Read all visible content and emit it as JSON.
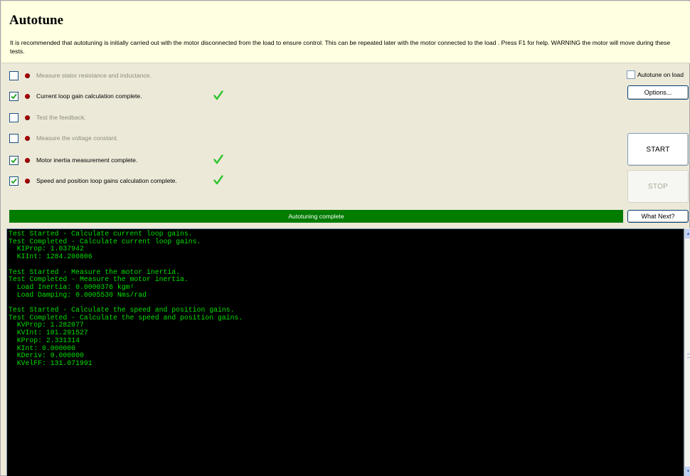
{
  "header": {
    "title": "Autotune",
    "description": "It is recommended that autotuning is initially carried out with the motor disconnected from the load to ensure control. This can be repeated later with the motor connected to the load . Press F1 for help. WARNING the motor will move during these tests."
  },
  "tasks": [
    {
      "label": "Measure stator resistance and inductance.",
      "checked": false,
      "complete": false
    },
    {
      "label": "Current loop gain calculation complete.",
      "checked": true,
      "complete": true
    },
    {
      "label": "Test the feedback.",
      "checked": false,
      "complete": false
    },
    {
      "label": "Measure the voltage constant.",
      "checked": false,
      "complete": false
    },
    {
      "label": "Motor inertia measurement complete.",
      "checked": true,
      "complete": true
    },
    {
      "label": "Speed and position loop gains calculation complete.",
      "checked": true,
      "complete": true
    }
  ],
  "options": {
    "autotune_on_load_label": "Autotune on load",
    "autotune_on_load_checked": false,
    "options_button": "Options...",
    "start_button": "START",
    "stop_button": "STOP",
    "what_next_button": "What Next?"
  },
  "status": {
    "text": "Autotuning complete",
    "color": "#007c00"
  },
  "console": {
    "text_color": "#00e000",
    "lines": [
      "Test Started - Calculate current loop gains.",
      "Test Completed - Calculate current loop gains.",
      "  KIProp: 1.037942",
      "  KIInt: 1284.200806",
      "",
      "Test Started - Measure the motor inertia.",
      "Test Completed - Measure the motor inertia.",
      "  Load Inertia: 0.0000376 kgm²",
      "  Load Damping: 0.0005530 Nms/rad",
      "",
      "Test Started - Calculate the speed and position gains.",
      "Test Completed - Calculate the speed and position gains.",
      "  KVProp: 1.282077",
      "  KVInt: 101.291527",
      "  KProp: 2.331314",
      "  KInt: 0.000000",
      "  KDeriv: 0.000000",
      "  KVelFF: 131.071991"
    ]
  },
  "icons": {
    "check": "checkmark-icon",
    "tick": "green-tick-icon",
    "status_dot": "status-dot-icon",
    "scroll_up": "scroll-up-arrow-icon",
    "scroll_down": "scroll-down-arrow-icon"
  }
}
